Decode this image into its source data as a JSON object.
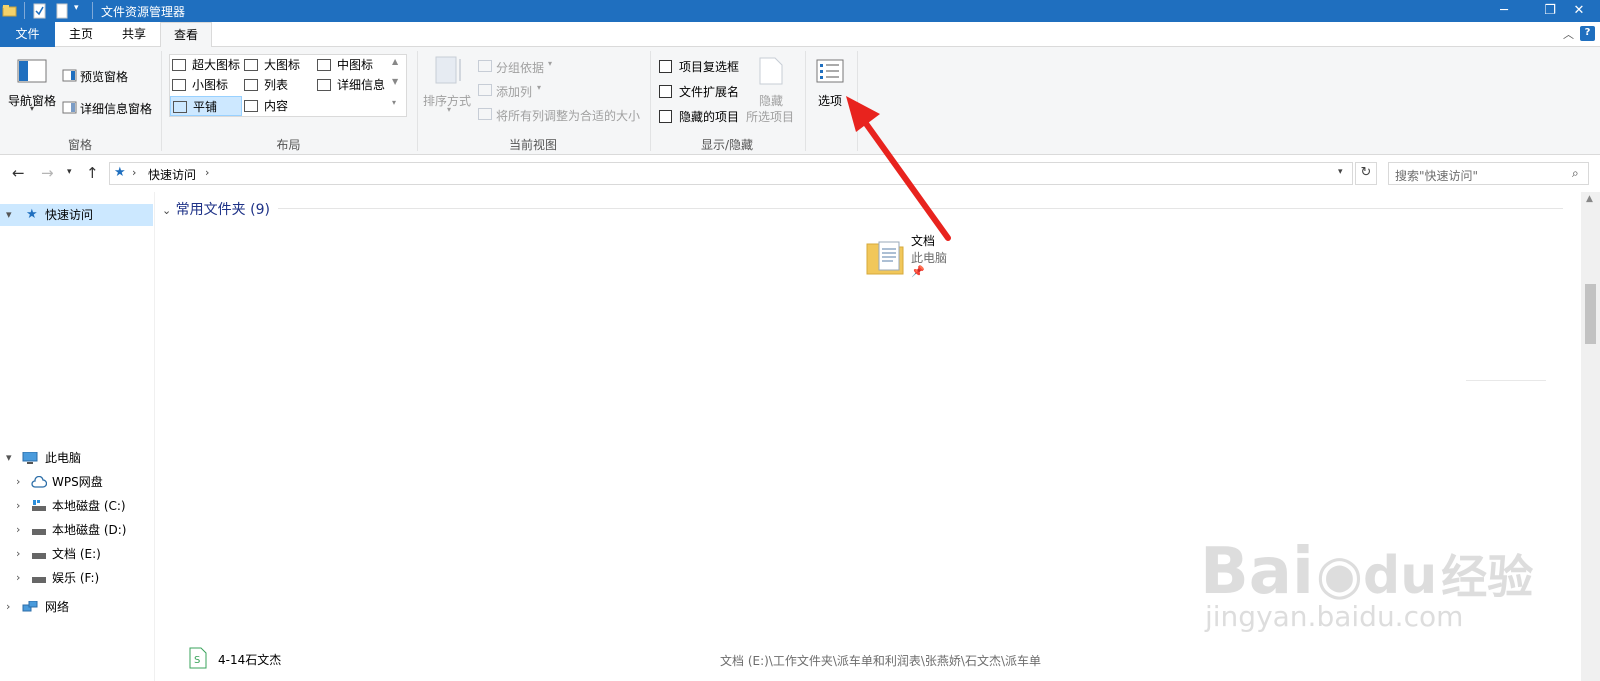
{
  "window": {
    "title": "文件资源管理器"
  },
  "ribbon_tabs": [
    "文件",
    "主页",
    "共享",
    "查看"
  ],
  "ribbon": {
    "pane_group": {
      "nav_pane": "导航窗格",
      "preview_pane": "预览窗格",
      "details_pane": "详细信息窗格",
      "label": "窗格"
    },
    "layout_group": {
      "items": [
        "超大图标",
        "大图标",
        "中图标",
        "小图标",
        "列表",
        "详细信息",
        "平铺",
        "内容"
      ],
      "selected": "平铺",
      "label": "布局"
    },
    "current_view_group": {
      "sort_by": "排序方式",
      "group_by": "分组依据",
      "add_columns": "添加列",
      "size_all_columns": "将所有列调整为合适的大小",
      "label": "当前视图"
    },
    "show_hide_group": {
      "item_checkboxes": "项目复选框",
      "file_extensions": "文件扩展名",
      "hidden_items": "隐藏的项目",
      "hide_selected_line1": "隐藏",
      "hide_selected_line2": "所选项目",
      "label": "显示/隐藏"
    },
    "options": "选项"
  },
  "address": {
    "path_segment": "快速访问",
    "search_placeholder": "搜索\"快速访问\""
  },
  "nav_pane": {
    "quick_access": "快速访问",
    "this_pc": "此电脑",
    "children": [
      "WPS网盘",
      "本地磁盘 (C:)",
      "本地磁盘 (D:)",
      "文档 (E:)",
      "娱乐 (F:)"
    ],
    "network": "网络"
  },
  "content": {
    "section_title": "常用文件夹 (9)",
    "tile": {
      "name": "文档",
      "location": "此电脑"
    },
    "recent_item": {
      "name": "4-14石文杰",
      "path": "文档 (E:)\\工作文件夹\\派车单和利润表\\张燕娇\\石文杰\\派车单"
    }
  },
  "watermark": {
    "brand": "Bai",
    "suffix": "经验",
    "url": "jingyan.baidu.com"
  },
  "colors": {
    "accent": "#1f6fbf",
    "annotation_arrow": "#e8231e",
    "selection": "#cce8ff"
  }
}
